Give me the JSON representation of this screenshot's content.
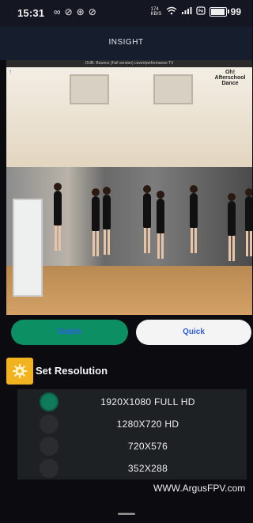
{
  "status_bar": {
    "time": "15:31",
    "left_icons": [
      "infinity-icon",
      "circle-check-icon",
      "settings-circle-icon",
      "circle-check-icon"
    ],
    "network_speed": "174 KB/S",
    "battery": "99"
  },
  "header": {
    "title": "INSIGHT"
  },
  "video": {
    "url_text": "OUB- Bounce (Full version) cover/performance TV",
    "logo_text": "Oh! Afterschool Dance"
  },
  "modes": {
    "stable_label": "Stable",
    "quick_label": "Quick",
    "selected": "Stable"
  },
  "resolution": {
    "title": "Set Resolution",
    "icon": "gear-icon",
    "options": [
      {
        "label": "1920X1080 FULL HD",
        "selected": true
      },
      {
        "label": "1280X720 HD",
        "selected": false
      },
      {
        "label": "720X576",
        "selected": false
      },
      {
        "label": "352X288",
        "selected": false
      }
    ]
  },
  "footer": {
    "brand": "WWW.ArgusFPV.com"
  },
  "colors": {
    "accent": "#0c8f63",
    "button_text": "#2e5fe0",
    "icon_bg": "#f2b320"
  }
}
